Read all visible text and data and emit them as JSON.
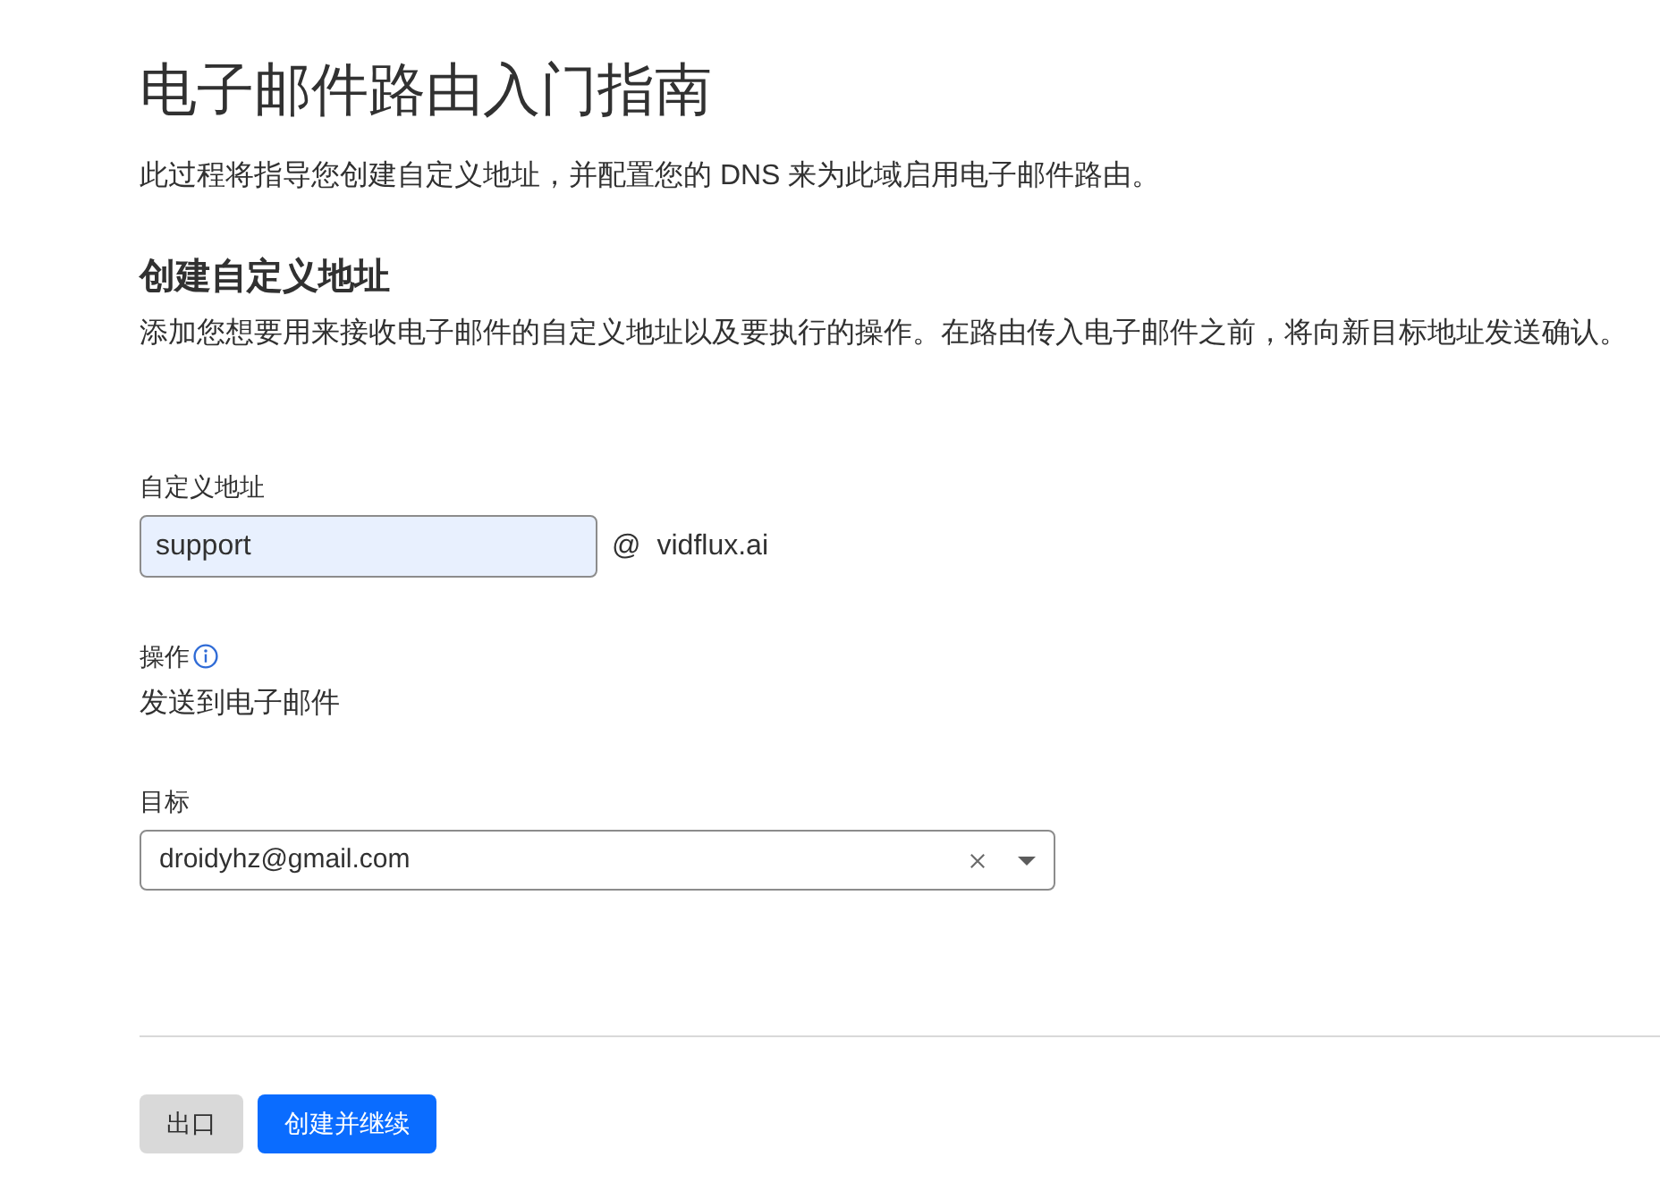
{
  "page": {
    "title": "电子邮件路由入门指南",
    "description": "此过程将指导您创建自定义地址，并配置您的 DNS 来为此域启用电子邮件路由。"
  },
  "section": {
    "heading": "创建自定义地址",
    "description": "添加您想要用来接收电子邮件的自定义地址以及要执行的操作。在路由传入电子邮件之前，将向新目标地址发送确认。"
  },
  "custom_address": {
    "label": "自定义地址",
    "value": "support",
    "separator": "@",
    "domain": "vidflux.ai"
  },
  "action": {
    "label": "操作",
    "value": "发送到电子邮件"
  },
  "destination": {
    "label": "目标",
    "value": "droidyhz@gmail.com"
  },
  "buttons": [
    {
      "label": "出口",
      "kind": "secondary"
    },
    {
      "label": "创建并继续",
      "kind": "primary"
    }
  ]
}
